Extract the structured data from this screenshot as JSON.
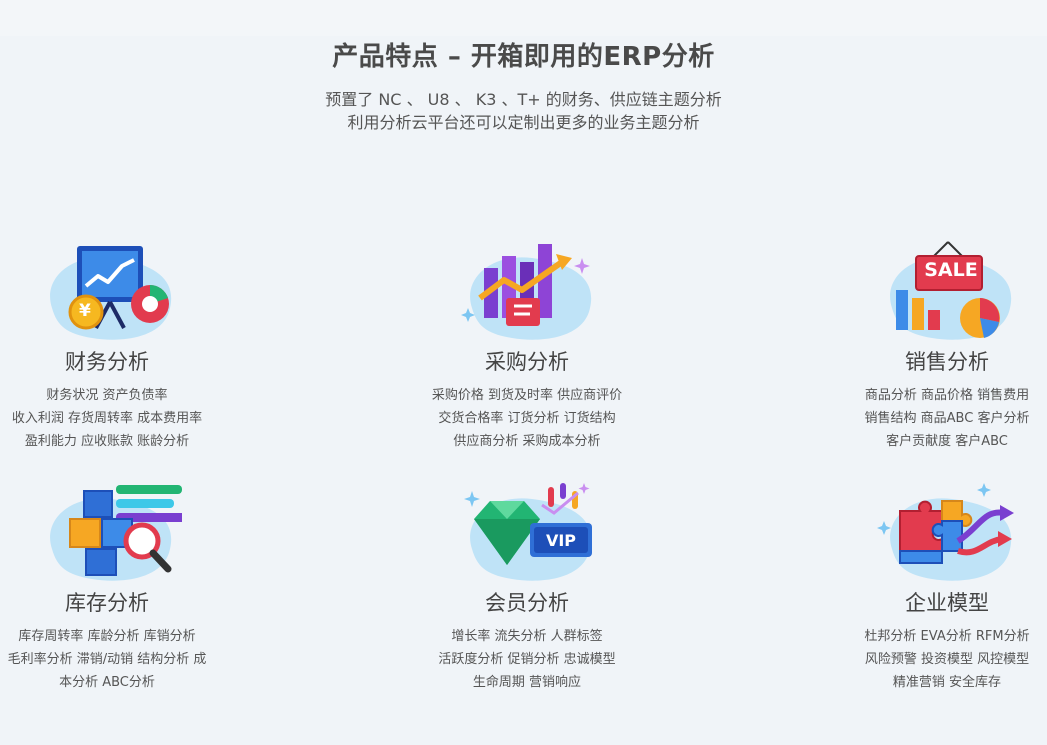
{
  "header": {
    "title": "产品特点 – 开箱即用的ERP分析",
    "subtitle_line1": "预置了 NC 、 U8 、 K3 、T+ 的财务、供应链主题分析",
    "subtitle_line2": "利用分析云平台还可以定制出更多的业务主题分析"
  },
  "cards": [
    {
      "title": "财务分析",
      "lines": [
        "财务状况 资产负债率",
        "收入利润 存货周转率 成本费用率",
        "盈利能力 应收账款 账龄分析"
      ]
    },
    {
      "title": "采购分析",
      "lines": [
        "采购价格 到货及时率 供应商评价",
        "交货合格率 订货分析 订货结构",
        "供应商分析 采购成本分析"
      ]
    },
    {
      "title": "销售分析",
      "lines": [
        "商品分析 商品价格 销售费用",
        "销售结构 商品ABC 客户分析",
        "客户贡献度 客户ABC"
      ]
    },
    {
      "title": "库存分析",
      "lines": [
        "库存周转率 库龄分析 库销分析",
        "毛利率分析 滞销/动销 结构分析 成",
        "本分析 ABC分析"
      ]
    },
    {
      "title": "会员分析",
      "lines": [
        "增长率 流失分析 人群标签",
        "活跃度分析 促销分析 忠诚模型",
        "生命周期 营销响应"
      ]
    },
    {
      "title": "企业模型",
      "lines": [
        "杜邦分析 EVA分析 RFM分析",
        "风险预警 投资模型 风控模型",
        "精准营销 安全库存"
      ]
    }
  ],
  "icons": {
    "sale_sign": "SALE",
    "vip_card": "VIP",
    "coin": "¥"
  },
  "colors": {
    "blob": "#bfe3f7",
    "blue": "#2f6fd6",
    "red": "#e23b4e",
    "orange": "#f6a723",
    "purple": "#7a3fd0",
    "green": "#22b573"
  }
}
